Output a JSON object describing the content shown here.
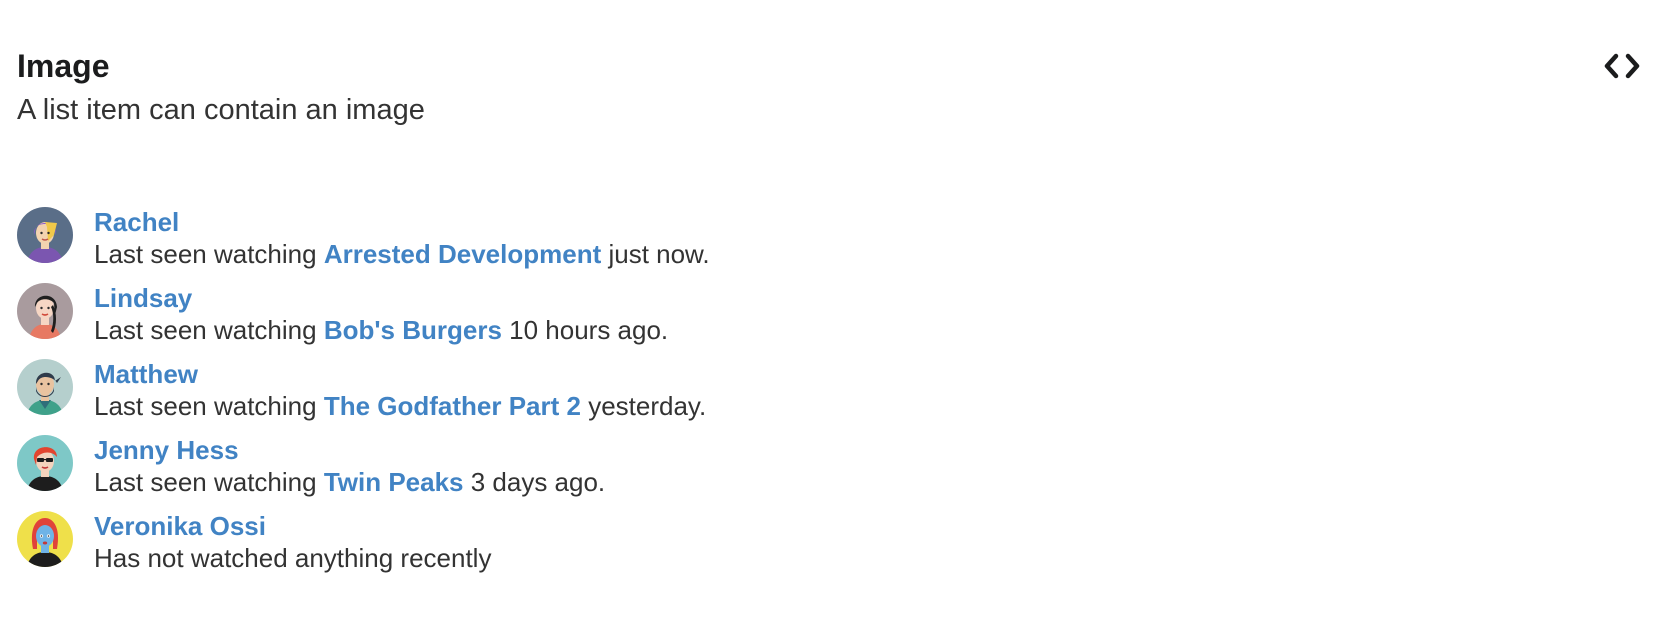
{
  "example": {
    "title": "Image",
    "description": "A list item can contain an image",
    "code_icon": "code-icon"
  },
  "list": [
    {
      "name": "Rachel",
      "prefix": "Last seen watching ",
      "show": "Arrested Development",
      "suffix": " just now.",
      "avatar_icon": "avatar-rachel",
      "avatar_bg": "#5a6e88"
    },
    {
      "name": "Lindsay",
      "prefix": "Last seen watching ",
      "show": "Bob's Burgers",
      "suffix": " 10 hours ago.",
      "avatar_icon": "avatar-lindsay",
      "avatar_bg": "#a99b9e"
    },
    {
      "name": "Matthew",
      "prefix": "Last seen watching ",
      "show": "The Godfather Part 2",
      "suffix": " yesterday.",
      "avatar_icon": "avatar-matthew",
      "avatar_bg": "#b5cfcd"
    },
    {
      "name": "Jenny Hess",
      "prefix": "Last seen watching ",
      "show": "Twin Peaks",
      "suffix": " 3 days ago.",
      "avatar_icon": "avatar-jenny",
      "avatar_bg": "#7ec8c7"
    },
    {
      "name": "Veronika Ossi",
      "prefix": "Has not watched anything recently",
      "show": "",
      "suffix": "",
      "avatar_icon": "avatar-veronika",
      "avatar_bg": "#efe04a"
    }
  ],
  "colors": {
    "link": "#4183c4",
    "text": "#333333",
    "heading": "#1b1c1d"
  }
}
